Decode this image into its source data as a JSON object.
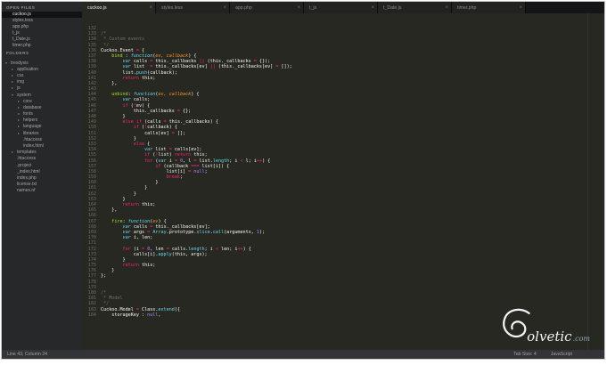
{
  "theme": {
    "editor-bg": "#272822",
    "sidebar-bg": "#27282a",
    "tabbar-bg": "#141517",
    "tab-bg": "#222320",
    "statusbar-bg": "#323438",
    "gutter-text": "#6c6e60",
    "text-default": "#f8f8f2",
    "accent-comment": "#75715e",
    "accent-keyword": "#f92672",
    "accent-storage": "#66d9ef",
    "accent-param": "#fd971f",
    "accent-function": "#a6e22e",
    "accent-constant": "#ae81ff",
    "logo-suffix-color": "#8fa6b2"
  },
  "icons": {
    "close": "×",
    "expanded": "▾",
    "collapsed": "▸"
  },
  "sidebar": {
    "open_files_header": "OPEN FILES",
    "open_files": [
      {
        "name": "cuckoo.js",
        "active": true
      },
      {
        "name": "styles.less"
      },
      {
        "name": "app.php"
      },
      {
        "name": "t_js"
      },
      {
        "name": "t_Date.js"
      },
      {
        "name": "timer.php"
      }
    ],
    "folders_header": "FOLDERS",
    "tree": [
      {
        "name": "tresdysis",
        "depth": 0,
        "kind": "folder",
        "open": true
      },
      {
        "name": "application",
        "depth": 1,
        "kind": "folder"
      },
      {
        "name": "css",
        "depth": 1,
        "kind": "folder"
      },
      {
        "name": "img",
        "depth": 1,
        "kind": "folder"
      },
      {
        "name": "js",
        "depth": 1,
        "kind": "folder"
      },
      {
        "name": "system",
        "depth": 1,
        "kind": "folder",
        "open": true
      },
      {
        "name": "core",
        "depth": 2,
        "kind": "folder"
      },
      {
        "name": "database",
        "depth": 2,
        "kind": "folder"
      },
      {
        "name": "fonts",
        "depth": 2,
        "kind": "folder"
      },
      {
        "name": "helpers",
        "depth": 2,
        "kind": "folder"
      },
      {
        "name": "language",
        "depth": 2,
        "kind": "folder"
      },
      {
        "name": "libraries",
        "depth": 2,
        "kind": "folder"
      },
      {
        "name": ".htaccess",
        "depth": 2,
        "kind": "file"
      },
      {
        "name": "index.html",
        "depth": 2,
        "kind": "file"
      },
      {
        "name": "templates",
        "depth": 1,
        "kind": "folder"
      },
      {
        "name": ".htaccess",
        "depth": 1,
        "kind": "file"
      },
      {
        "name": ".project",
        "depth": 1,
        "kind": "file"
      },
      {
        "name": "_index.html",
        "depth": 1,
        "kind": "file"
      },
      {
        "name": "index.php",
        "depth": 1,
        "kind": "file"
      },
      {
        "name": "license.txt",
        "depth": 1,
        "kind": "file"
      },
      {
        "name": "names.nf",
        "depth": 1,
        "kind": "file"
      }
    ]
  },
  "tabs": [
    {
      "label": "cuckoo.js",
      "active": true
    },
    {
      "label": "styles.less"
    },
    {
      "label": "app.php"
    },
    {
      "label": "t_js"
    },
    {
      "label": "t_Date.js"
    },
    {
      "label": "timer.php"
    }
  ],
  "editor": {
    "first_line_number": 132,
    "lines": [
      [],
      [
        [
          "cm",
          "/*"
        ]
      ],
      [
        [
          "cm",
          " * Custom events"
        ]
      ],
      [
        [
          "cm",
          " */"
        ]
      ],
      [
        [
          "tx",
          "Cuckoo.Event "
        ],
        [
          "kw",
          "="
        ],
        [
          "tx",
          " {"
        ]
      ],
      [
        [
          "tx",
          "    "
        ],
        [
          "fn",
          "bind"
        ],
        [
          "tx",
          " : "
        ],
        [
          "st",
          "function"
        ],
        [
          "tx",
          "("
        ],
        [
          "pa",
          "ev, callback"
        ],
        [
          "tx",
          ") {"
        ]
      ],
      [
        [
          "tx",
          "        "
        ],
        [
          "st",
          "var"
        ],
        [
          "tx",
          " calls "
        ],
        [
          "kw",
          "="
        ],
        [
          "tx",
          " this._callbacks "
        ],
        [
          "kw",
          "||"
        ],
        [
          "tx",
          " (this._callbacks "
        ],
        [
          "kw",
          "="
        ],
        [
          "tx",
          " {});"
        ]
      ],
      [
        [
          "tx",
          "        "
        ],
        [
          "st",
          "var"
        ],
        [
          "tx",
          " list  "
        ],
        [
          "kw",
          "="
        ],
        [
          "tx",
          " this._callbacks[ev] "
        ],
        [
          "kw",
          "||"
        ],
        [
          "tx",
          " (this._callbacks[ev] "
        ],
        [
          "kw",
          "="
        ],
        [
          "tx",
          " []);"
        ]
      ],
      [
        [
          "tx",
          "        list."
        ],
        [
          "su",
          "push"
        ],
        [
          "tx",
          "(callback);"
        ]
      ],
      [
        [
          "tx",
          "        "
        ],
        [
          "kw",
          "return"
        ],
        [
          "tx",
          " this;"
        ]
      ],
      [
        [
          "tx",
          "    },"
        ]
      ],
      [],
      [
        [
          "tx",
          "    "
        ],
        [
          "fn",
          "unbind"
        ],
        [
          "tx",
          ": "
        ],
        [
          "st",
          "function"
        ],
        [
          "tx",
          "("
        ],
        [
          "pa",
          "ev, callback"
        ],
        [
          "tx",
          ") {"
        ]
      ],
      [
        [
          "tx",
          "        "
        ],
        [
          "st",
          "var"
        ],
        [
          "tx",
          " calls;"
        ]
      ],
      [
        [
          "tx",
          "        "
        ],
        [
          "kw",
          "if"
        ],
        [
          "tx",
          " ("
        ],
        [
          "kw",
          "!"
        ],
        [
          "tx",
          "ev) {"
        ]
      ],
      [
        [
          "tx",
          "            this._callbacks "
        ],
        [
          "kw",
          "="
        ],
        [
          "tx",
          " {};"
        ]
      ],
      [
        [
          "tx",
          "        }"
        ]
      ],
      [
        [
          "tx",
          "        "
        ],
        [
          "kw",
          "else"
        ],
        [
          "tx",
          " "
        ],
        [
          "kw",
          "if"
        ],
        [
          "tx",
          " (calls "
        ],
        [
          "kw",
          "="
        ],
        [
          "tx",
          " this._callbacks) {"
        ]
      ],
      [
        [
          "tx",
          "            "
        ],
        [
          "kw",
          "if"
        ],
        [
          "tx",
          " ("
        ],
        [
          "kw",
          "!"
        ],
        [
          "tx",
          "callback) {"
        ]
      ],
      [
        [
          "tx",
          "                calls[ev] "
        ],
        [
          "kw",
          "="
        ],
        [
          "tx",
          " [];"
        ]
      ],
      [
        [
          "tx",
          "            }"
        ]
      ],
      [
        [
          "tx",
          "            "
        ],
        [
          "kw",
          "else"
        ],
        [
          "tx",
          " {"
        ]
      ],
      [
        [
          "tx",
          "                "
        ],
        [
          "st",
          "var"
        ],
        [
          "tx",
          " list "
        ],
        [
          "kw",
          "="
        ],
        [
          "tx",
          " calls[ev];"
        ]
      ],
      [
        [
          "tx",
          "                "
        ],
        [
          "kw",
          "if"
        ],
        [
          "tx",
          " ("
        ],
        [
          "kw",
          "!"
        ],
        [
          "tx",
          "list) "
        ],
        [
          "kw",
          "return"
        ],
        [
          "tx",
          " this;"
        ]
      ],
      [
        [
          "tx",
          "                "
        ],
        [
          "kw",
          "for"
        ],
        [
          "tx",
          " ("
        ],
        [
          "st",
          "var"
        ],
        [
          "tx",
          " i "
        ],
        [
          "kw",
          "="
        ],
        [
          "tx",
          " "
        ],
        [
          "nu",
          "0"
        ],
        [
          "tx",
          ", l "
        ],
        [
          "kw",
          "="
        ],
        [
          "tx",
          " list."
        ],
        [
          "su",
          "length"
        ],
        [
          "tx",
          "; i "
        ],
        [
          "kw",
          "<"
        ],
        [
          "tx",
          " l; i"
        ],
        [
          "kw",
          "++"
        ],
        [
          "tx",
          ") {"
        ]
      ],
      [
        [
          "tx",
          "                    "
        ],
        [
          "kw",
          "if"
        ],
        [
          "tx",
          " (callback "
        ],
        [
          "kw",
          "==="
        ],
        [
          "tx",
          " list[i]) {"
        ]
      ],
      [
        [
          "tx",
          "                        list[i] "
        ],
        [
          "kw",
          "="
        ],
        [
          "tx",
          " "
        ],
        [
          "nu",
          "null"
        ],
        [
          "tx",
          ";"
        ]
      ],
      [
        [
          "tx",
          "                        "
        ],
        [
          "kw",
          "break"
        ],
        [
          "tx",
          ";"
        ]
      ],
      [
        [
          "tx",
          "                    }"
        ]
      ],
      [
        [
          "tx",
          "                }"
        ]
      ],
      [
        [
          "tx",
          "            }"
        ]
      ],
      [
        [
          "tx",
          "        }"
        ]
      ],
      [
        [
          "tx",
          "        "
        ],
        [
          "kw",
          "return"
        ],
        [
          "tx",
          " this;"
        ]
      ],
      [
        [
          "tx",
          "    },"
        ]
      ],
      [],
      [
        [
          "tx",
          "    "
        ],
        [
          "fn",
          "fire"
        ],
        [
          "tx",
          ": "
        ],
        [
          "st",
          "function"
        ],
        [
          "tx",
          "("
        ],
        [
          "pa",
          "ev"
        ],
        [
          "tx",
          ") {"
        ]
      ],
      [
        [
          "tx",
          "        "
        ],
        [
          "st",
          "var"
        ],
        [
          "tx",
          " calls "
        ],
        [
          "kw",
          "="
        ],
        [
          "tx",
          " this._callbacks[ev];"
        ]
      ],
      [
        [
          "tx",
          "        "
        ],
        [
          "st",
          "var"
        ],
        [
          "tx",
          " args "
        ],
        [
          "kw",
          "="
        ],
        [
          "tx",
          " "
        ],
        [
          "su",
          "Array"
        ],
        [
          "tx",
          ".prototype."
        ],
        [
          "su",
          "slice"
        ],
        [
          "tx",
          "."
        ],
        [
          "su",
          "call"
        ],
        [
          "tx",
          "(arguments, "
        ],
        [
          "nu",
          "1"
        ],
        [
          "tx",
          ");"
        ]
      ],
      [
        [
          "tx",
          "        "
        ],
        [
          "st",
          "var"
        ],
        [
          "tx",
          " i, len;"
        ]
      ],
      [],
      [
        [
          "tx",
          "        "
        ],
        [
          "kw",
          "for"
        ],
        [
          "tx",
          " (i "
        ],
        [
          "kw",
          "="
        ],
        [
          "tx",
          " "
        ],
        [
          "nu",
          "0"
        ],
        [
          "tx",
          ", len "
        ],
        [
          "kw",
          "="
        ],
        [
          "tx",
          " calls."
        ],
        [
          "su",
          "length"
        ],
        [
          "tx",
          "; i "
        ],
        [
          "kw",
          "<"
        ],
        [
          "tx",
          " len; i"
        ],
        [
          "kw",
          "++"
        ],
        [
          "tx",
          ") {"
        ]
      ],
      [
        [
          "tx",
          "            calls[i]."
        ],
        [
          "su",
          "apply"
        ],
        [
          "tx",
          "(this, args);"
        ]
      ],
      [
        [
          "tx",
          "        }"
        ]
      ],
      [
        [
          "tx",
          "        "
        ],
        [
          "kw",
          "return"
        ],
        [
          "tx",
          " this;"
        ]
      ],
      [
        [
          "tx",
          "    }"
        ]
      ],
      [
        [
          "tx",
          "};"
        ]
      ],
      [],
      [],
      [
        [
          "cm",
          "/*"
        ]
      ],
      [
        [
          "cm",
          " * Model"
        ]
      ],
      [
        [
          "cm",
          " */"
        ]
      ],
      [
        [
          "tx",
          "Cuckoo.Model "
        ],
        [
          "kw",
          "="
        ],
        [
          "tx",
          " Class."
        ],
        [
          "su",
          "extend"
        ],
        [
          "tx",
          "({"
        ]
      ],
      [
        [
          "tx",
          "    storageKey : "
        ],
        [
          "nu",
          "null"
        ],
        [
          "tx",
          ","
        ]
      ]
    ]
  },
  "statusbar": {
    "position": "Line 43, Column 24",
    "tab_size": "Tab Size: 4",
    "language": "JavaScript"
  },
  "logo": {
    "brand": "Solvetic",
    "wordmark": "olvetic",
    "suffix": ".com"
  }
}
